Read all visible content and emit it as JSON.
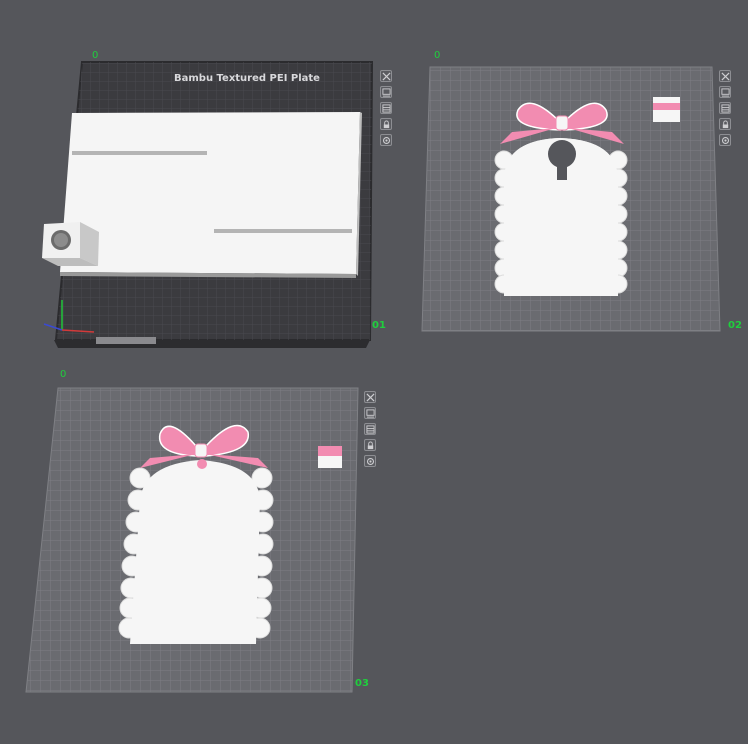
{
  "colors": {
    "background": "#55565b",
    "plate_dark": "#3a3a3e",
    "plate_light": "#6a6b70",
    "grid": "#7b7c82",
    "part_white": "#f6f6f6",
    "bow_pink": "#f28cb1",
    "label_green": "#1fcf3d"
  },
  "plates": [
    {
      "index": "01",
      "top_mark": "0",
      "title": "Bambu Textured PEI Plate"
    },
    {
      "index": "02",
      "top_mark": "0"
    },
    {
      "index": "03",
      "top_mark": "0"
    }
  ],
  "plate_tools": [
    {
      "name": "delete-plate",
      "icon": "close-icon"
    },
    {
      "name": "arrange-plate",
      "icon": "arrange-icon"
    },
    {
      "name": "orient-plate",
      "icon": "grid-icon"
    },
    {
      "name": "lock-plate",
      "icon": "lock-icon"
    },
    {
      "name": "plate-settings",
      "icon": "gear-icon"
    }
  ]
}
